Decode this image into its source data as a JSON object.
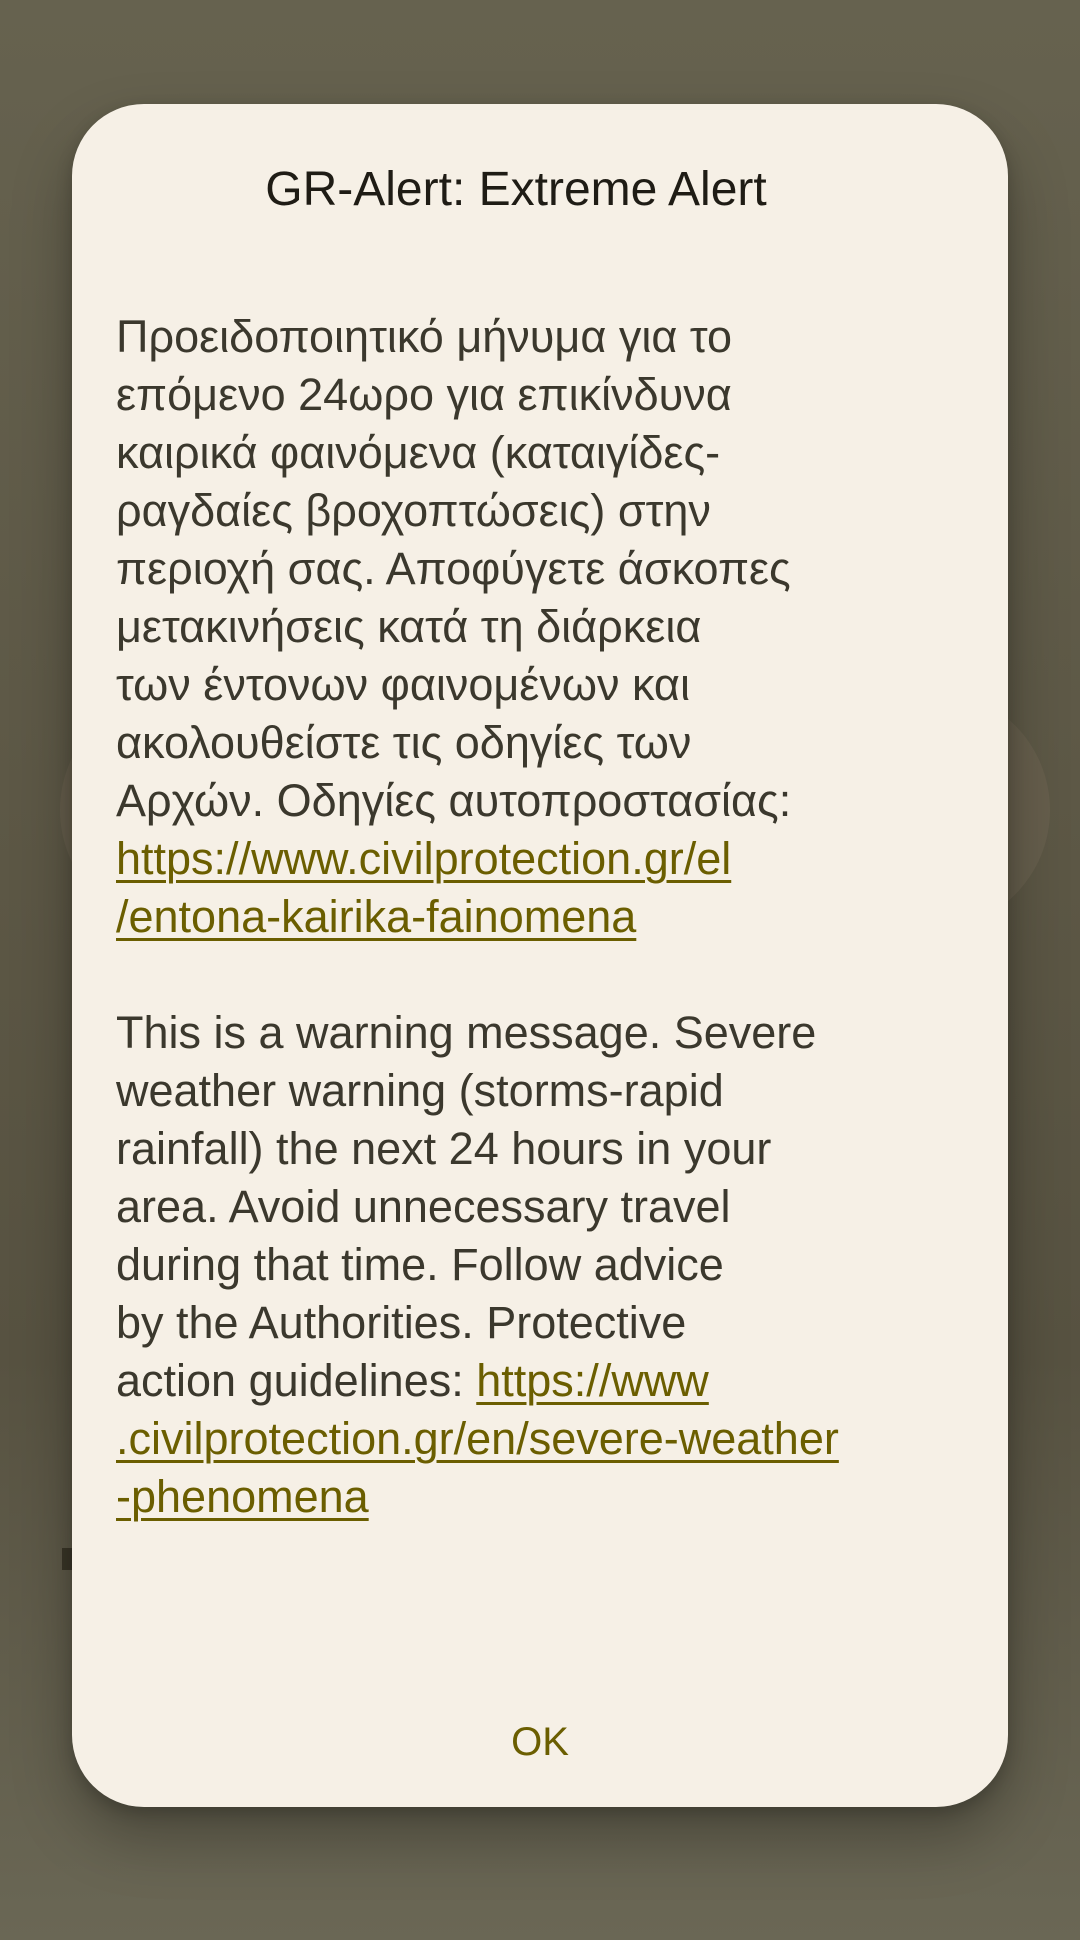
{
  "dialog": {
    "title": "GR-Alert: Extreme Alert",
    "greek_message": {
      "text_lines": [
        "Προειδοποιητικό μήνυμα για το",
        "επόμενο 24ωρο για επικίνδυνα",
        "καιρικά φαινόμενα (καταιγίδες-",
        "ραγδαίες βροχοπτώσεις) στην",
        "περιοχή σας. Αποφύγετε άσκοπες",
        "μετακινήσεις κατά τη διάρκεια",
        "των έντονων φαινομένων και",
        "ακολουθείστε τις οδηγίες των",
        "Αρχών. Οδηγίες αυτοπροστασίας:"
      ],
      "link_lines": [
        "https://www.civilprotection.gr/el",
        "/entona-kairika-fainomena"
      ]
    },
    "english_message": {
      "text_lines": [
        "This is a warning message. Severe",
        "weather warning (storms-rapid",
        "rainfall) the next 24 hours in your",
        "area. Avoid unnecessary travel",
        "during that time. Follow advice",
        "by the Authorities. Protective"
      ],
      "last_text_prefix": "action guidelines: ",
      "link_lines": [
        "https://www",
        ".civilprotection.gr/en/severe-weather",
        "-phenomena"
      ]
    },
    "ok_label": "OK"
  },
  "colors": {
    "scrim": "#5f5a4a",
    "dialog_background": "#f6f0e6",
    "title_text": "#1f1c15",
    "body_text": "#3b382d",
    "accent_link": "#6b5e00"
  }
}
